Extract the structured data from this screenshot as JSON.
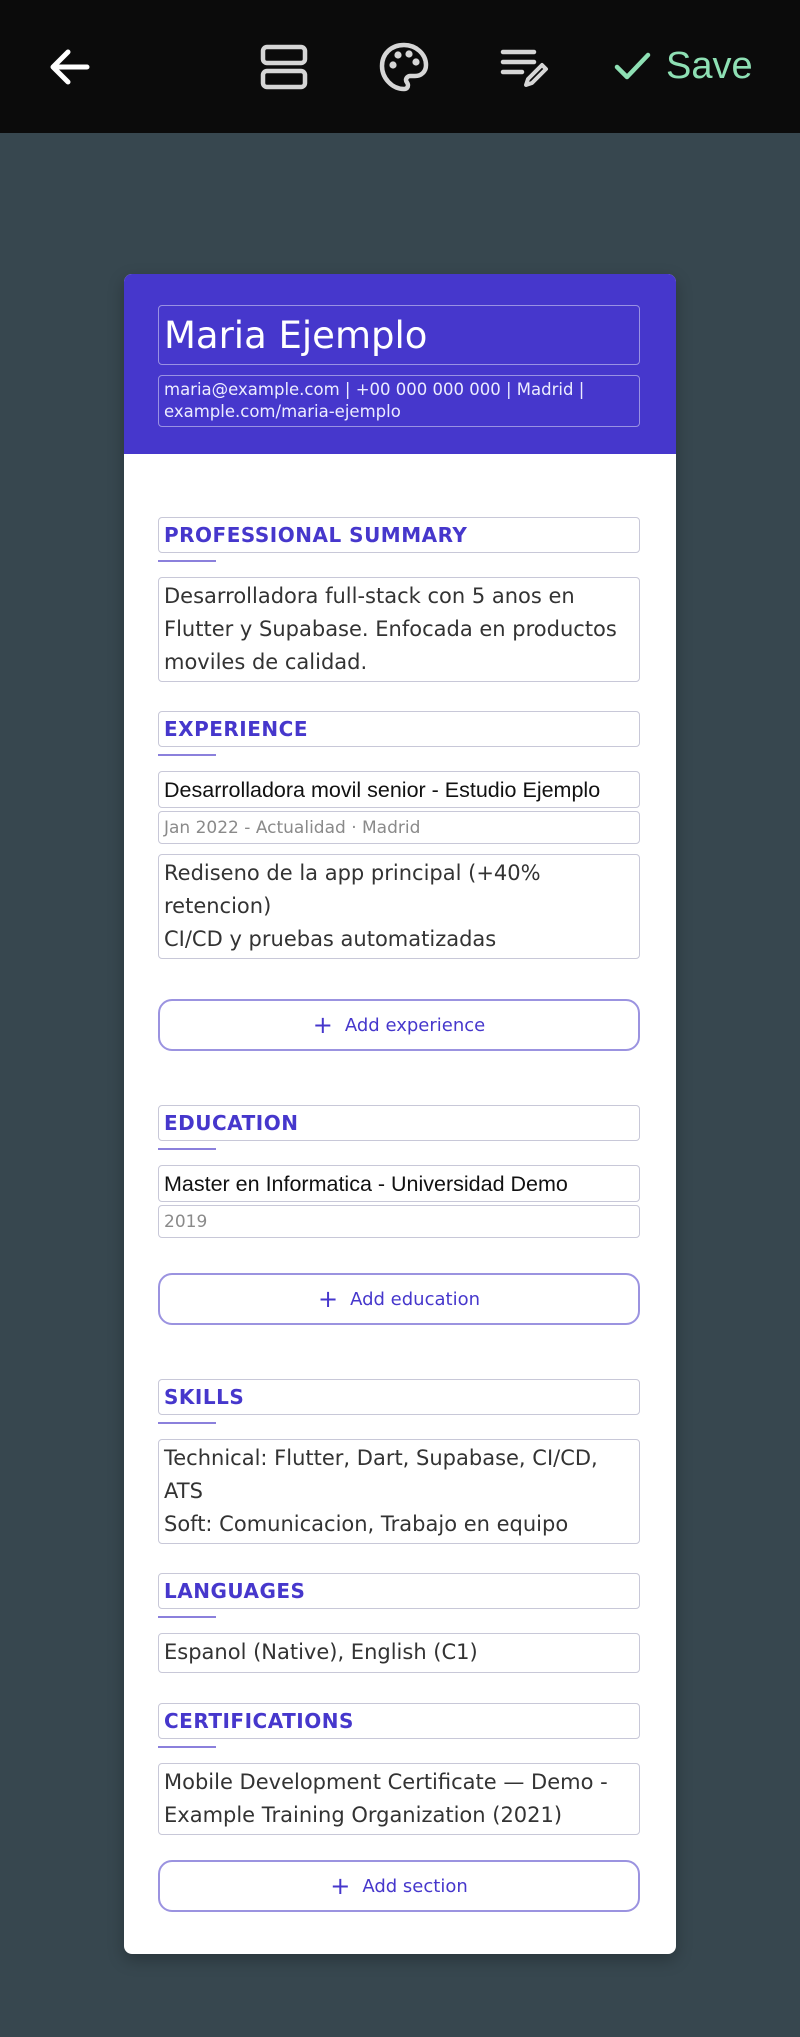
{
  "toolbar": {
    "back_icon": "arrow-left-icon",
    "sections_icon": "sections-icon",
    "palette_icon": "palette-icon",
    "edit_icon": "edit-list-icon",
    "save_label": "Save",
    "save_color": "#8ee0b4"
  },
  "resume": {
    "accent": "#4637cc",
    "name": "Maria Ejemplo",
    "contact": "maria@example.com  |  +00 000 000 000  |  Madrid  |  example.com/maria-ejemplo",
    "summary": {
      "title": "PROFESSIONAL SUMMARY",
      "text": "Desarrolladora full-stack con 5 anos en Flutter y Supabase. Enfocada en productos moviles de calidad."
    },
    "experience": {
      "title": "EXPERIENCE",
      "job_title": "Desarrolladora movil senior - Estudio Ejemplo",
      "job_meta": "Jan 2022 - Actualidad · Madrid",
      "job_bullets": "Rediseno de la app principal (+40% retencion)\nCI/CD y pruebas automatizadas",
      "add_label": "Add experience"
    },
    "education": {
      "title": "EDUCATION",
      "degree": "Master en Informatica - Universidad Demo",
      "year": "2019",
      "add_label": "Add education"
    },
    "skills": {
      "title": "SKILLS",
      "text": "Technical: Flutter, Dart, Supabase, CI/CD, ATS\nSoft: Comunicacion, Trabajo en equipo"
    },
    "languages": {
      "title": "LANGUAGES",
      "text": "Espanol (Native), English (C1)"
    },
    "certifications": {
      "title": "CERTIFICATIONS",
      "text": "Mobile Development Certificate — Demo - Example Training Organization (2021)"
    },
    "add_section_label": "Add section"
  }
}
